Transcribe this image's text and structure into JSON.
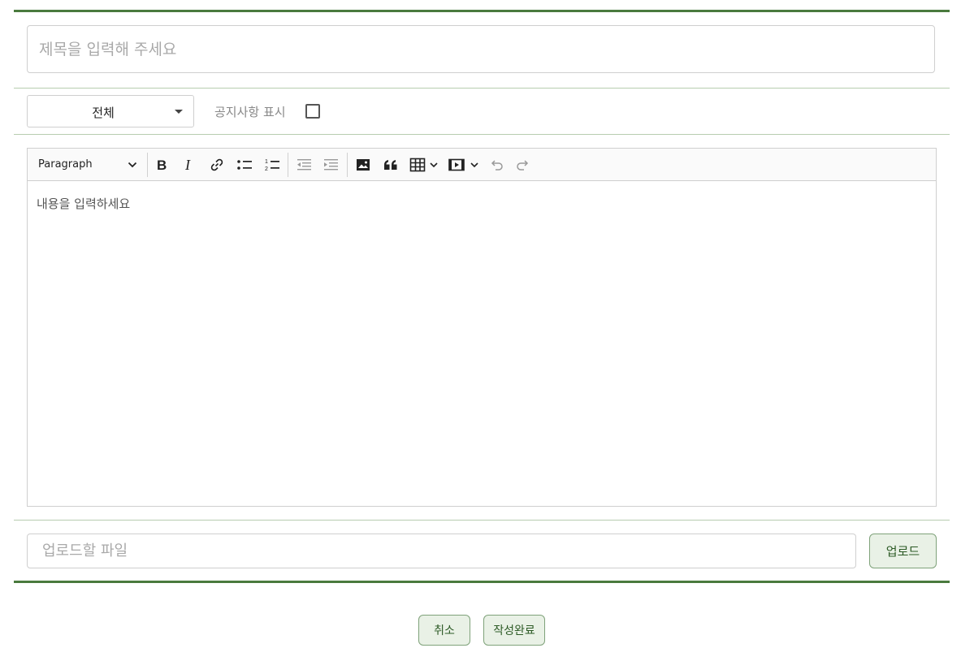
{
  "form": {
    "title_placeholder": "제목을 입력해 주세요",
    "category_value": "전체",
    "notice_label": "공지사항 표시",
    "notice_checked": false,
    "editor": {
      "block_format": "Paragraph",
      "toolbar_icons": [
        "bold-icon",
        "italic-icon",
        "link-icon",
        "bulleted-list-icon",
        "numbered-list-icon",
        "outdent-icon",
        "indent-icon",
        "image-icon",
        "quote-icon",
        "table-icon",
        "media-icon",
        "undo-icon",
        "redo-icon"
      ],
      "content_placeholder": "내용을 입력하세요"
    },
    "file_placeholder": "업로드할 파일",
    "upload_label": "업로드",
    "cancel_label": "취소",
    "submit_label": "작성완료"
  },
  "colors": {
    "accent_dark": "#4a7a3e",
    "accent_light": "#b7cdb0",
    "button_bg": "#e9f1e6",
    "button_text": "#2c5a25"
  }
}
